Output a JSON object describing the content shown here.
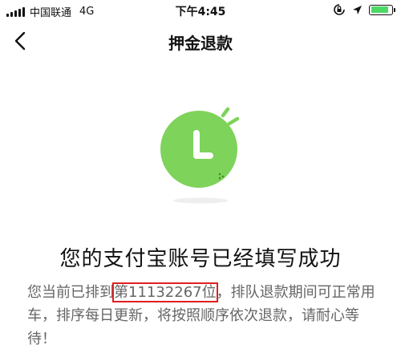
{
  "status_bar": {
    "carrier": "中国联通",
    "network": "4G",
    "time": "下午4:45"
  },
  "nav": {
    "title": "押金退款"
  },
  "illustration": {
    "icon": "clock-icon",
    "color": "#7ed35a"
  },
  "content": {
    "title": "您的支付宝账号已经填写成功",
    "message_prefix": "您当前已排到",
    "queue_position": "第11132267位",
    "message_suffix": "，排队退款期间可正常用车，排序每日更新，将按照顺序依次退款，请耐心等待！"
  },
  "colors": {
    "accent_green": "#7ed35a",
    "highlight_red": "#e02020",
    "text_gray": "#666666"
  }
}
